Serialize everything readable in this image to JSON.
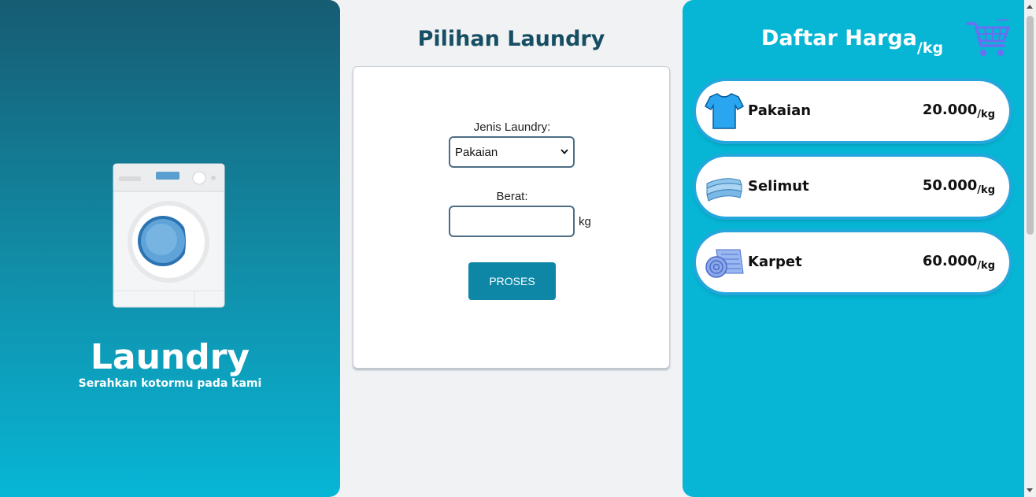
{
  "left": {
    "title": "Laundry",
    "subtitle": "Serahkan kotormu pada kami",
    "image_icon": "washing-machine-icon"
  },
  "form": {
    "heading": "Pilihan Laundry",
    "type_label": "Jenis Laundry:",
    "type_value": "Pakaian",
    "weight_label": "Berat:",
    "weight_value": "",
    "weight_unit": "kg",
    "submit_label": "PROSES"
  },
  "prices": {
    "title": "Daftar Harga",
    "title_unit": "/kg",
    "cart_icon": "cart-icon",
    "items": [
      {
        "name": "Pakaian",
        "price": "20.000",
        "unit": "/kg",
        "icon": "shirt-icon"
      },
      {
        "name": "Selimut",
        "price": "50.000",
        "unit": "/kg",
        "icon": "blanket-icon"
      },
      {
        "name": "Karpet",
        "price": "60.000",
        "unit": "/kg",
        "icon": "carpet-roll-icon"
      }
    ]
  },
  "colors": {
    "left_gradient_top": "#165c73",
    "left_gradient_bottom": "#07b6d6",
    "right_panel": "#06b6d4",
    "heading": "#164e63",
    "button": "#0e87a6",
    "pill_border": "#23a7dc",
    "cart": "#6a6ef0"
  }
}
